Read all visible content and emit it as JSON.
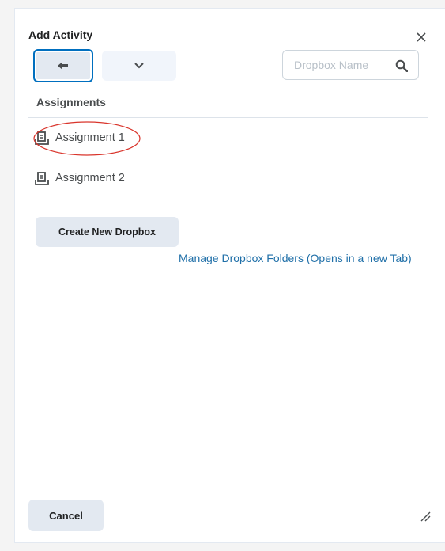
{
  "dialog": {
    "title": "Add Activity",
    "close_icon": "close-icon"
  },
  "toolbar": {
    "back_icon": "arrow-left-icon",
    "menu_icon": "chevron-down-icon",
    "search": {
      "placeholder": "Dropbox Name",
      "value": "",
      "icon": "search-icon"
    }
  },
  "section": {
    "title": "Assignments"
  },
  "items": [
    {
      "label": "Assignment 1",
      "icon": "dropbox-icon"
    },
    {
      "label": "Assignment 2",
      "icon": "dropbox-icon"
    }
  ],
  "actions": {
    "create_label": "Create New Dropbox",
    "manage_link": "Manage Dropbox Folders (Opens in a new Tab)",
    "cancel_label": "Cancel"
  },
  "colors": {
    "accent": "#006fbf",
    "link": "#1f6fa8",
    "button_bg": "#e3e9f1",
    "annotation": "#d9342b"
  }
}
